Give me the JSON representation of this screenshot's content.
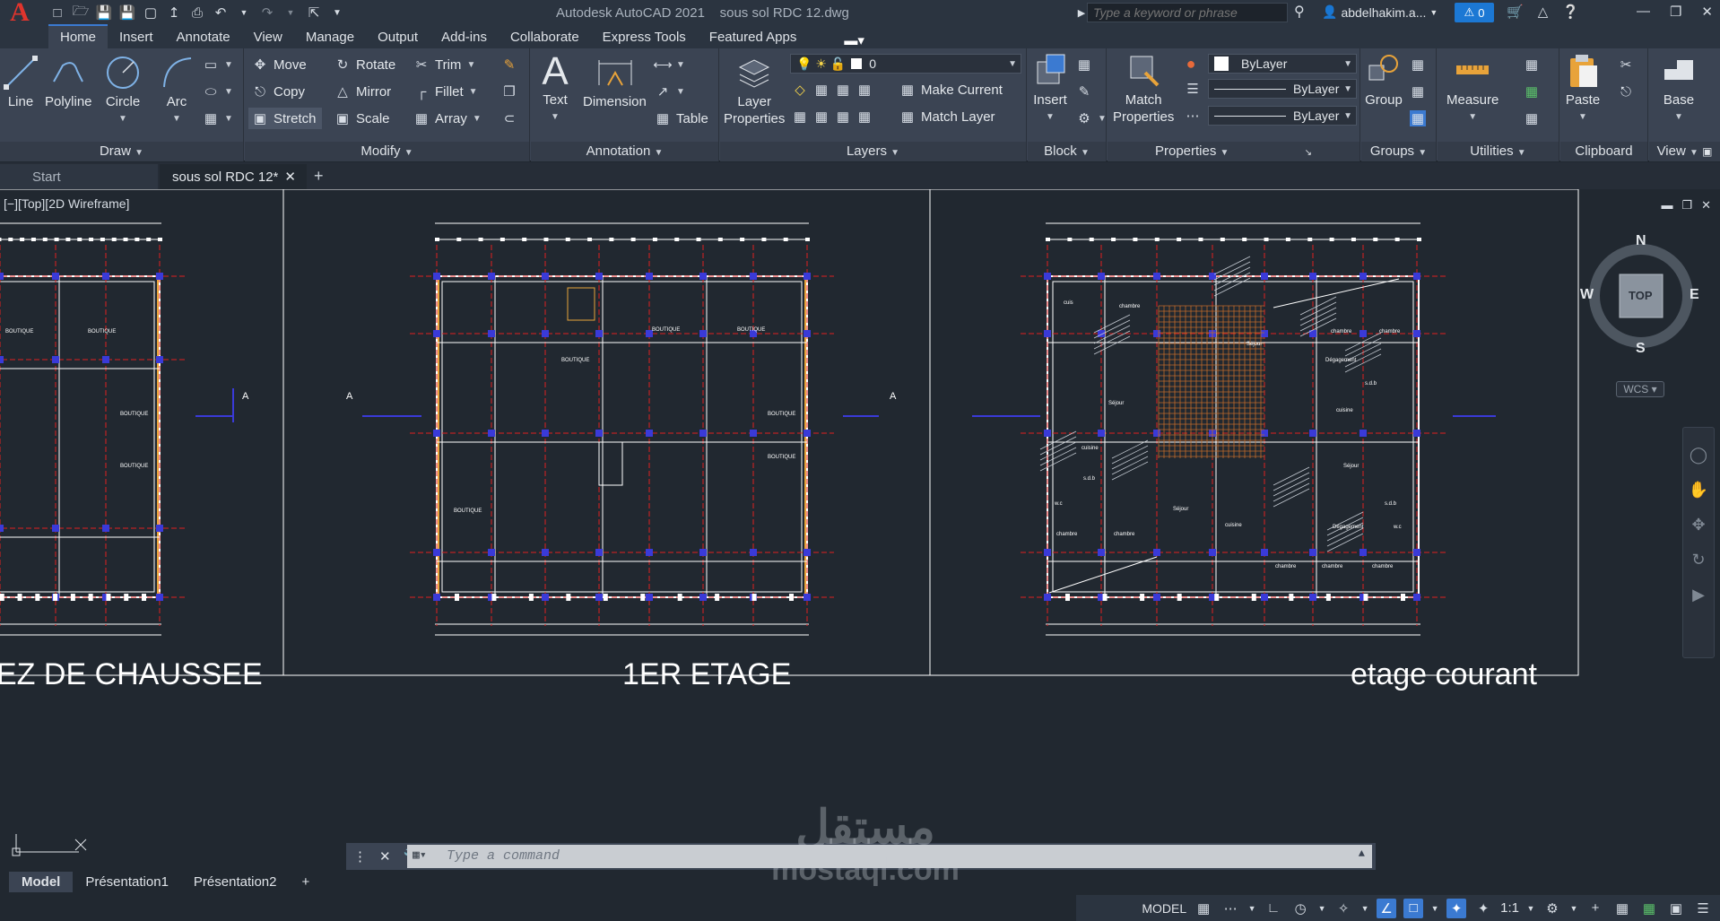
{
  "titlebar": {
    "app_name": "Autodesk AutoCAD 2021",
    "file_name": "sous sol  RDC   12.dwg",
    "search_placeholder": "Type a keyword or phrase",
    "user": "abdelhakim.a...",
    "notification_count": "0"
  },
  "ribbon_tabs": [
    "Home",
    "Insert",
    "Annotate",
    "View",
    "Manage",
    "Output",
    "Add-ins",
    "Collaborate",
    "Express Tools",
    "Featured Apps"
  ],
  "ribbon": {
    "draw": {
      "title": "Draw",
      "line": "Line",
      "polyline": "Polyline",
      "circle": "Circle",
      "arc": "Arc"
    },
    "modify": {
      "title": "Modify",
      "move": "Move",
      "rotate": "Rotate",
      "trim": "Trim",
      "copy": "Copy",
      "mirror": "Mirror",
      "fillet": "Fillet",
      "stretch": "Stretch",
      "scale": "Scale",
      "array": "Array"
    },
    "annotation": {
      "title": "Annotation",
      "text": "Text",
      "dimension": "Dimension",
      "table": "Table"
    },
    "layers": {
      "title": "Layers",
      "layer_properties_1": "Layer",
      "layer_properties_2": "Properties",
      "current_layer": "0",
      "make_current": "Make Current",
      "match_layer": "Match Layer"
    },
    "block": {
      "title": "Block",
      "insert": "Insert"
    },
    "properties": {
      "title": "Properties",
      "match_1": "Match",
      "match_2": "Properties",
      "color": "ByLayer",
      "linetype": "ByLayer",
      "lineweight": "ByLayer"
    },
    "groups": {
      "title": "Groups",
      "group": "Group"
    },
    "utilities": {
      "title": "Utilities",
      "measure": "Measure"
    },
    "clipboard": {
      "title": "Clipboard",
      "paste": "Paste"
    },
    "view": {
      "title": "View",
      "base": "Base"
    }
  },
  "file_tabs": {
    "start": "Start",
    "active": "sous sol  RDC   12*"
  },
  "viewport": {
    "label": "[−][Top][2D Wireframe]",
    "plans": [
      {
        "title": "EZ DE CHAUSSEE"
      },
      {
        "title": "1ER ETAGE"
      },
      {
        "title": "etage courant"
      }
    ],
    "room_labels": {
      "boutique": "BOUTIQUE",
      "chambre": "chambre",
      "sejour": "Séjour",
      "cuisine": "cuisine",
      "sdb": "s.d.b",
      "wc": "w.c",
      "degagement": "Dégagement",
      "cuis": "cuis"
    },
    "section_marker": "A"
  },
  "viewcube": {
    "n": "N",
    "s": "S",
    "e": "E",
    "w": "W",
    "face": "TOP",
    "wcs": "WCS"
  },
  "command_line": {
    "placeholder": "Type a command"
  },
  "layout_tabs": [
    "Model",
    "Présentation1",
    "Présentation2"
  ],
  "status": {
    "model": "MODEL",
    "scale": "1:1"
  },
  "watermark": {
    "line1": "مستقل",
    "line2": "mostaql.com"
  },
  "colors": {
    "accent": "#3b7ad1",
    "background": "#212830",
    "ribbon": "#3b4453",
    "axis": "#e02020",
    "wall": "#ffffff",
    "column": "#3a3ad8",
    "hatch": "#c06a2a"
  }
}
